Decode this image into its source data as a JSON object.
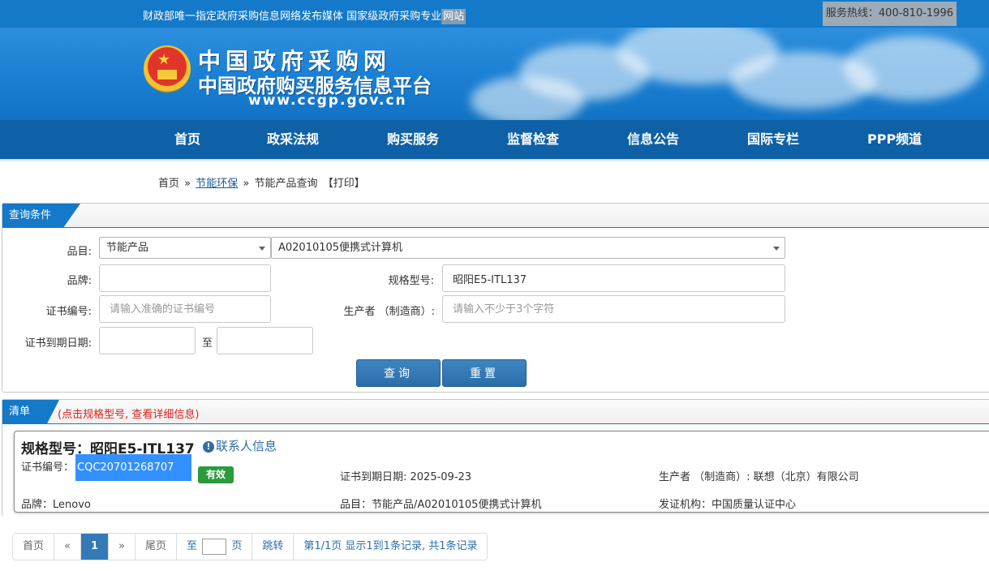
{
  "topbar": {
    "slogan_a": "财政部唯一指定政府采购信息网络发布媒体 国家级政府采购专业",
    "slogan_b": "网站",
    "hotline": "服务热线：400-810-1996"
  },
  "header": {
    "title": "中国政府采购网",
    "subtitle": "中国政府购买服务信息平台",
    "url": "www.ccgp.gov.cn"
  },
  "nav": {
    "items": [
      {
        "label": "首页"
      },
      {
        "label": "政采法规"
      },
      {
        "label": "购买服务"
      },
      {
        "label": "监督检查"
      },
      {
        "label": "信息公告"
      },
      {
        "label": "国际专栏"
      },
      {
        "label": "PPP频道"
      }
    ]
  },
  "breadcrumb": {
    "home": "首页",
    "sep": "»",
    "category": "节能环保",
    "current": "节能产品查询",
    "print": "【打印】"
  },
  "query": {
    "tab_label": "查询条件",
    "category_label": "品目:",
    "category_value": "节能产品",
    "subcategory_value": "A02010105便携式计算机",
    "brand_label": "品牌:",
    "brand_value": "",
    "model_label": "规格型号:",
    "model_value": "昭阳E5-ITL137",
    "cert_label": "证书编号:",
    "cert_placeholder": "请输入准确的证书编号",
    "maker_label": "生产者 （制造商）:",
    "maker_placeholder": "请输入不少于3个字符",
    "expiry_label": "证书到期日期:",
    "to_label": "至",
    "search_button": "查询",
    "reset_button": "重置"
  },
  "results": {
    "tab_label": "清单",
    "hint": "(点击规格型号, 查看详细信息)",
    "items": [
      {
        "model_title": "规格型号：昭阳E5-ITL137",
        "contact_link": "联系人信息",
        "cert_label": "证书编号：",
        "cert_no": "CQC20701268707",
        "status": "有效",
        "expiry": "证书到期日期: 2025-09-23",
        "maker": "生产者 （制造商）: 联想（北京）有限公司",
        "brand": "品牌：Lenovo",
        "category": "品目：节能产品/A02010105便携式计算机",
        "issuer": "发证机构：中国质量认证中心"
      }
    ]
  },
  "pagination": {
    "first": "首页",
    "prev": "«",
    "current": "1",
    "next": "»",
    "last": "尾页",
    "goto_prefix": "至",
    "goto_suffix": "页",
    "jump": "跳转",
    "summary": "第1/1页  显示1到1条记录, 共1条记录"
  },
  "colors": {
    "brand_blue": "#1479c8",
    "nav_blue": "#0e61a7",
    "valid_green": "#2a9a3a",
    "hint_red": "#d9231d"
  }
}
